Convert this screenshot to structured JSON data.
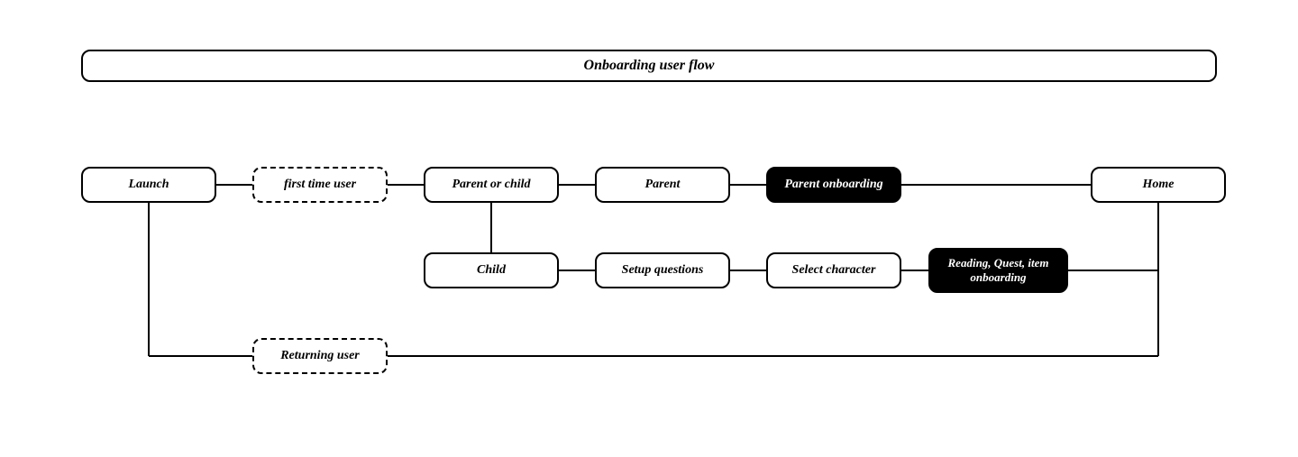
{
  "title": "Onboarding user flow",
  "nodes": {
    "launch": "Launch",
    "first_time": "first time user",
    "parent_or_child": "Parent or child",
    "parent": "Parent",
    "parent_onboarding": "Parent onboarding",
    "home": "Home",
    "child": "Child",
    "setup_questions": "Setup questions",
    "select_character": "Select character",
    "reading_quest": "Reading, Quest, item onboarding",
    "returning_user": "Returning user"
  }
}
